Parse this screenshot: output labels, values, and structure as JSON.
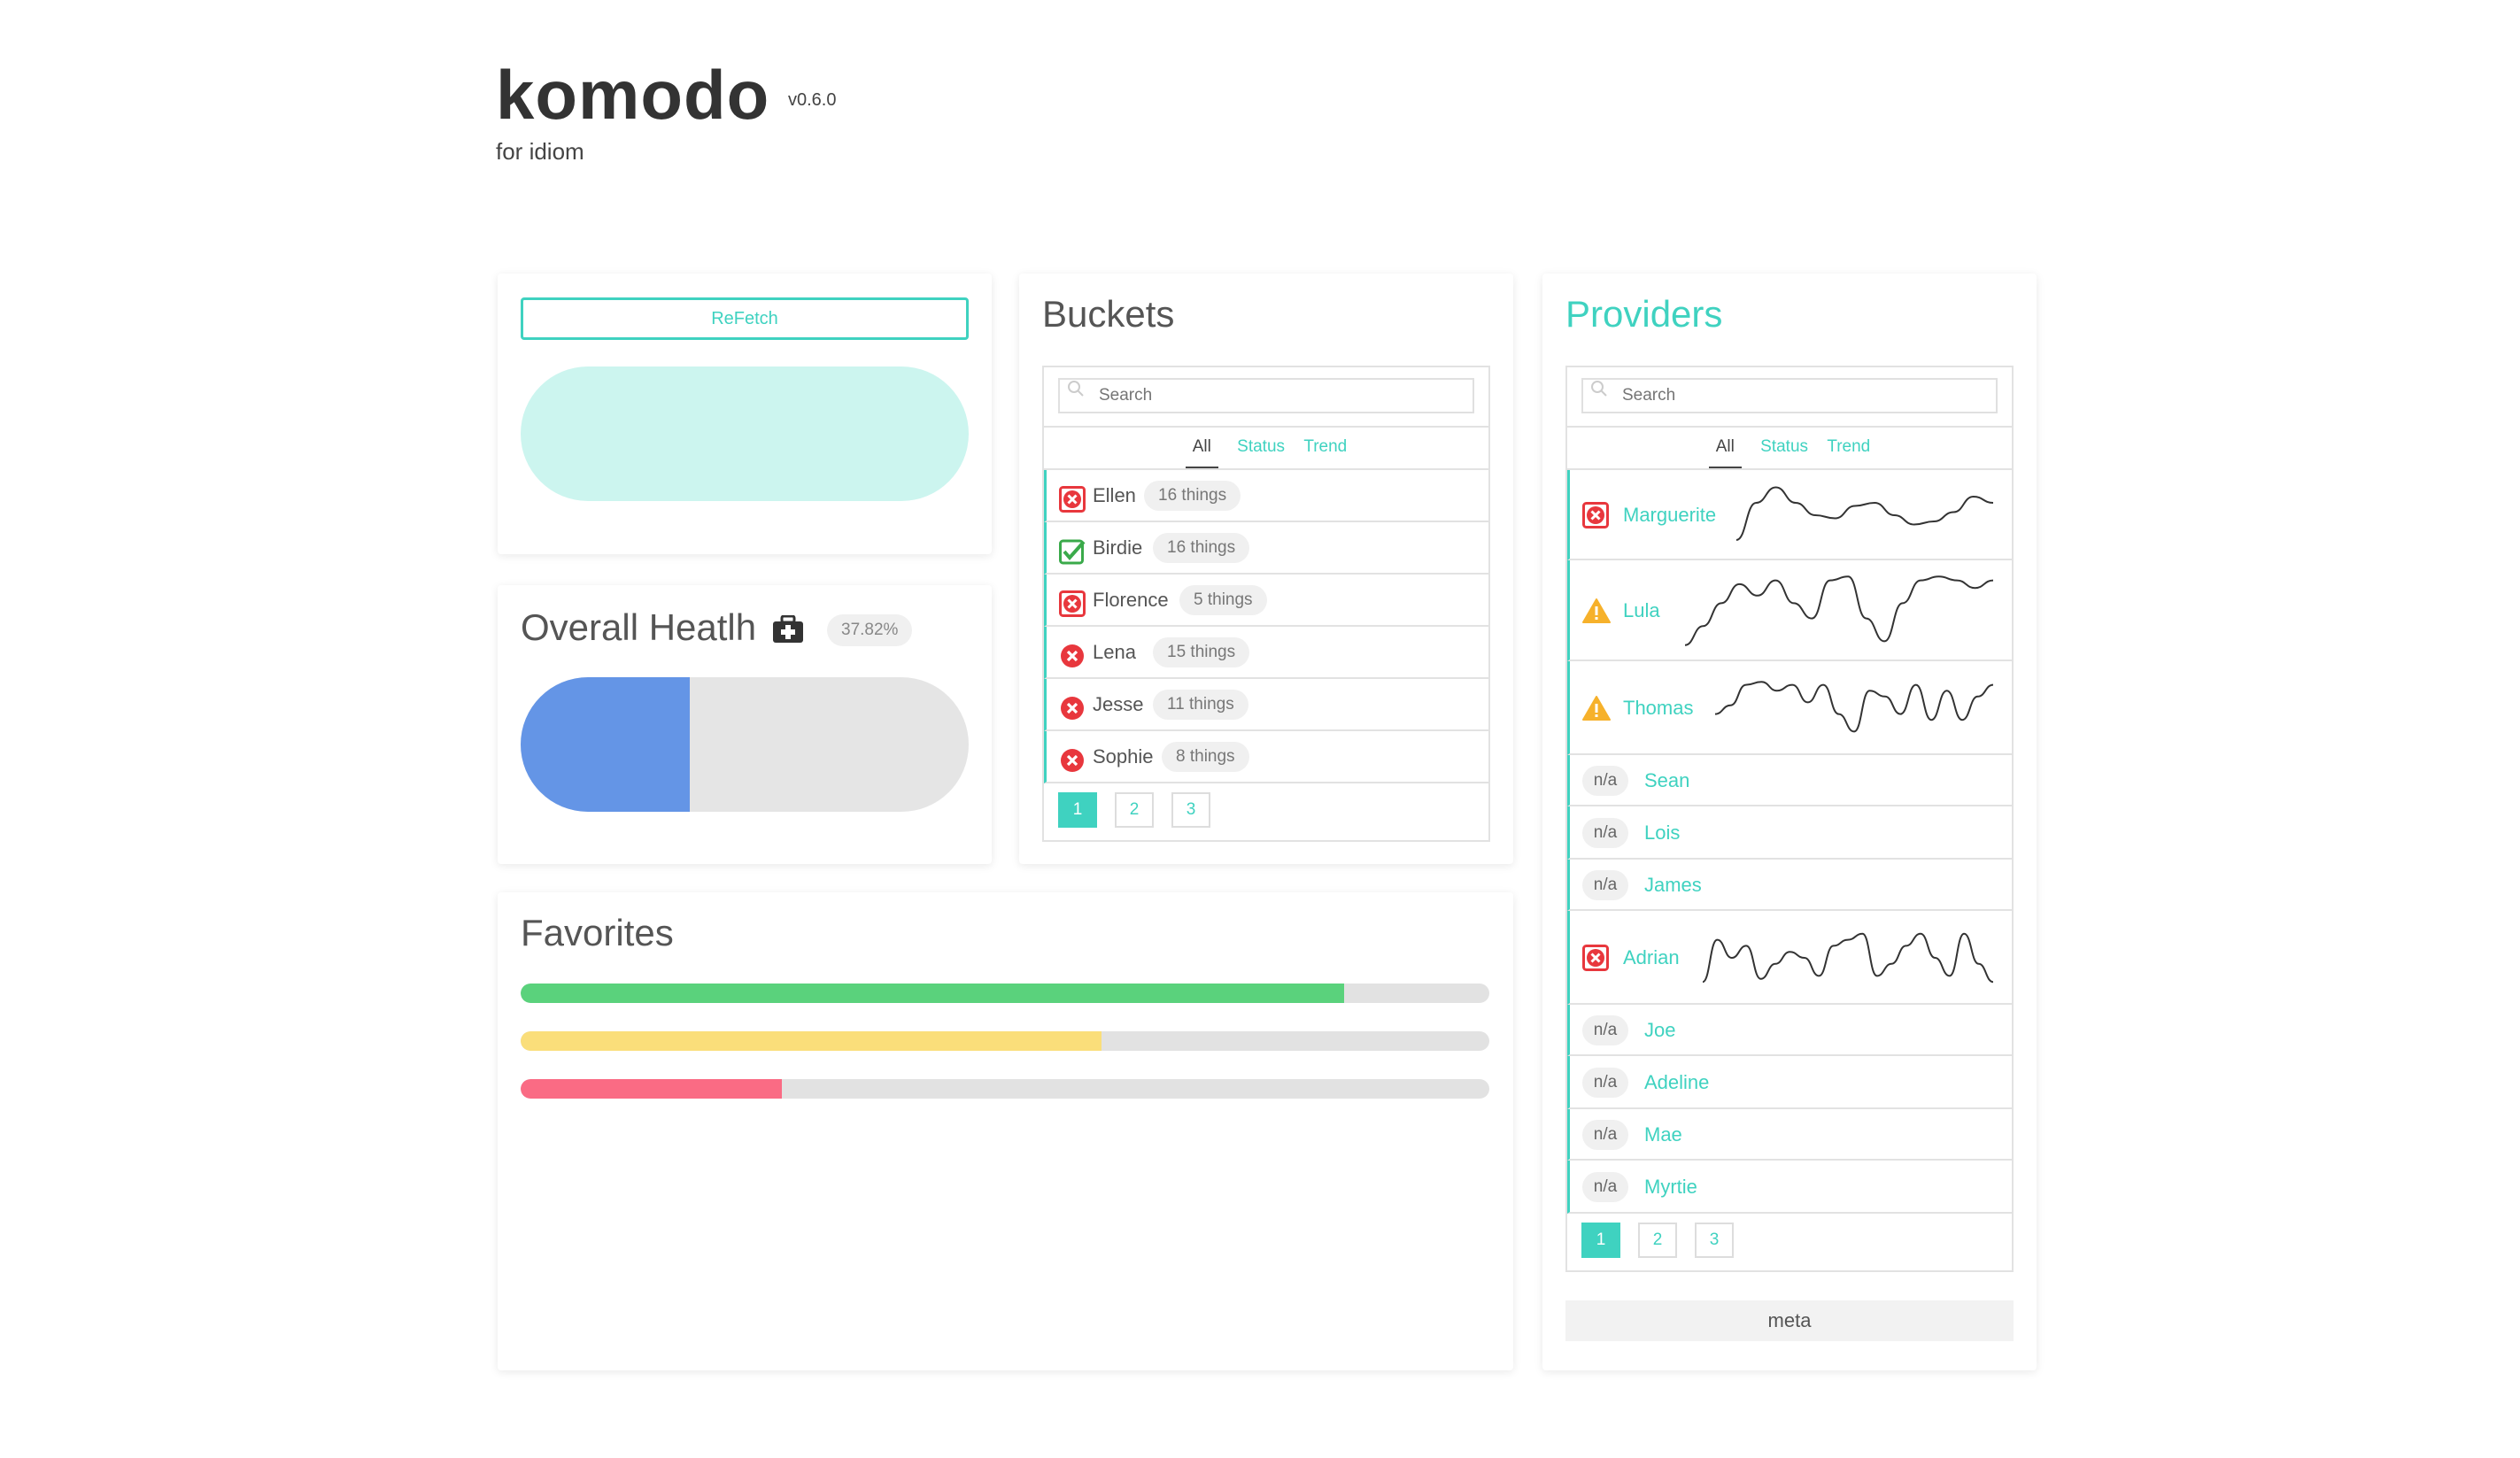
{
  "header": {
    "title": "komodo",
    "version": "v0.6.0",
    "subtitle": "for idiom"
  },
  "refetch": {
    "label": "ReFetch"
  },
  "health": {
    "title": "Overall Heatlh",
    "percent_label": "37.82%",
    "percent": 37.82,
    "icon": "medical-kit-icon",
    "fill_color": "#6495e6"
  },
  "buckets": {
    "title": "Buckets",
    "search_placeholder": "Search",
    "filters": {
      "all": "All",
      "status": "Status",
      "trend": "Trend"
    },
    "rows": [
      {
        "name": "Ellen",
        "count": "16 things",
        "status": "error-square"
      },
      {
        "name": "Birdie",
        "count": "16 things",
        "status": "ok"
      },
      {
        "name": "Florence",
        "count": "5 things",
        "status": "error-square"
      },
      {
        "name": "Lena",
        "count": "15 things",
        "status": "error-circle"
      },
      {
        "name": "Jesse",
        "count": "11 things",
        "status": "error-circle"
      },
      {
        "name": "Sophie",
        "count": "8 things",
        "status": "error-circle"
      }
    ],
    "pages": [
      "1",
      "2",
      "3"
    ],
    "active_page": "1"
  },
  "providers": {
    "title": "Providers",
    "search_placeholder": "Search",
    "filters": {
      "all": "All",
      "status": "Status",
      "trend": "Trend"
    },
    "rows": [
      {
        "name": "Marguerite",
        "status": "error",
        "badge": ""
      },
      {
        "name": "Lula",
        "status": "warning",
        "badge": ""
      },
      {
        "name": "Thomas",
        "status": "warning",
        "badge": ""
      },
      {
        "name": "Sean",
        "status": "none",
        "badge": "n/a"
      },
      {
        "name": "Lois",
        "status": "none",
        "badge": "n/a"
      },
      {
        "name": "James",
        "status": "none",
        "badge": "n/a"
      },
      {
        "name": "Adrian",
        "status": "error",
        "badge": ""
      },
      {
        "name": "Joe",
        "status": "none",
        "badge": "n/a"
      },
      {
        "name": "Adeline",
        "status": "none",
        "badge": "n/a"
      },
      {
        "name": "Mae",
        "status": "none",
        "badge": "n/a"
      },
      {
        "name": "Myrtie",
        "status": "none",
        "badge": "n/a"
      }
    ],
    "pages": [
      "1",
      "2",
      "3"
    ],
    "active_page": "1",
    "meta_label": "meta"
  },
  "favorites": {
    "title": "Favorites",
    "bars": [
      {
        "value": 0.85,
        "color": "#5ad27c"
      },
      {
        "value": 0.6,
        "color": "#fade7a"
      },
      {
        "value": 0.27,
        "color": "#fa6b84"
      }
    ]
  },
  "colors": {
    "accent": "#3fd2c0",
    "error": "#e8373d",
    "ok": "#3aaa4a",
    "warning": "#f6b12b"
  }
}
